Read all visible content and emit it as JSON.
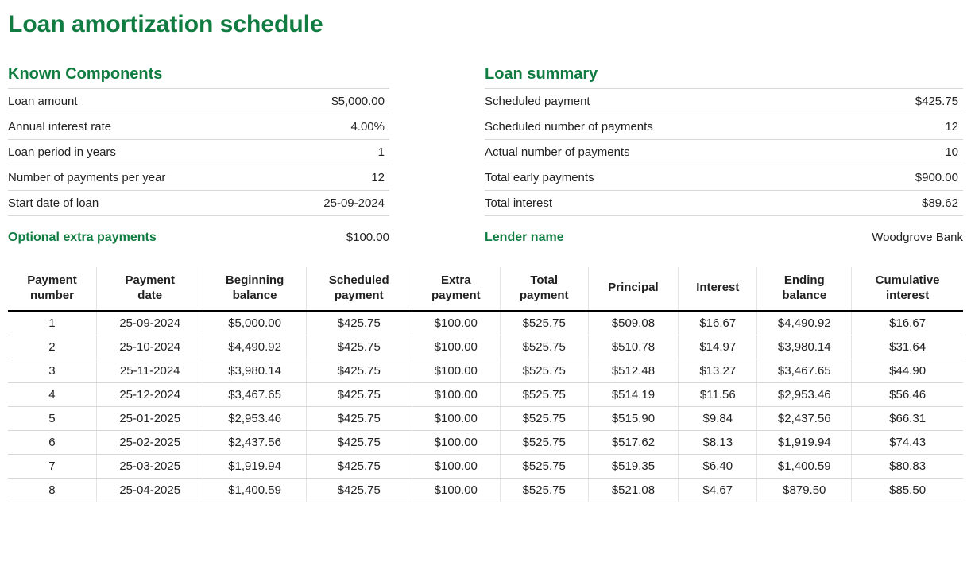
{
  "title": "Loan amortization schedule",
  "known": {
    "heading": "Known Components",
    "rows": [
      {
        "label": "Loan amount",
        "value": "$5,000.00"
      },
      {
        "label": "Annual interest rate",
        "value": "4.00%"
      },
      {
        "label": "Loan period in years",
        "value": "1"
      },
      {
        "label": "Number of payments per year",
        "value": "12"
      },
      {
        "label": "Start date of loan",
        "value": "25-09-2024"
      }
    ],
    "extra_label": "Optional extra payments",
    "extra_value": "$100.00"
  },
  "summary": {
    "heading": "Loan summary",
    "rows": [
      {
        "label": "Scheduled payment",
        "value": "$425.75"
      },
      {
        "label": "Scheduled number of payments",
        "value": "12"
      },
      {
        "label": "Actual number of payments",
        "value": "10"
      },
      {
        "label": "Total early payments",
        "value": "$900.00"
      },
      {
        "label": "Total interest",
        "value": "$89.62"
      }
    ],
    "lender_label": "Lender name",
    "lender_value": "Woodgrove Bank"
  },
  "schedule": {
    "headers": [
      "Payment number",
      "Payment date",
      "Beginning balance",
      "Scheduled payment",
      "Extra payment",
      "Total payment",
      "Principal",
      "Interest",
      "Ending balance",
      "Cumulative interest"
    ],
    "rows": [
      [
        "1",
        "25-09-2024",
        "$5,000.00",
        "$425.75",
        "$100.00",
        "$525.75",
        "$509.08",
        "$16.67",
        "$4,490.92",
        "$16.67"
      ],
      [
        "2",
        "25-10-2024",
        "$4,490.92",
        "$425.75",
        "$100.00",
        "$525.75",
        "$510.78",
        "$14.97",
        "$3,980.14",
        "$31.64"
      ],
      [
        "3",
        "25-11-2024",
        "$3,980.14",
        "$425.75",
        "$100.00",
        "$525.75",
        "$512.48",
        "$13.27",
        "$3,467.65",
        "$44.90"
      ],
      [
        "4",
        "25-12-2024",
        "$3,467.65",
        "$425.75",
        "$100.00",
        "$525.75",
        "$514.19",
        "$11.56",
        "$2,953.46",
        "$56.46"
      ],
      [
        "5",
        "25-01-2025",
        "$2,953.46",
        "$425.75",
        "$100.00",
        "$525.75",
        "$515.90",
        "$9.84",
        "$2,437.56",
        "$66.31"
      ],
      [
        "6",
        "25-02-2025",
        "$2,437.56",
        "$425.75",
        "$100.00",
        "$525.75",
        "$517.62",
        "$8.13",
        "$1,919.94",
        "$74.43"
      ],
      [
        "7",
        "25-03-2025",
        "$1,919.94",
        "$425.75",
        "$100.00",
        "$525.75",
        "$519.35",
        "$6.40",
        "$1,400.59",
        "$80.83"
      ],
      [
        "8",
        "25-04-2025",
        "$1,400.59",
        "$425.75",
        "$100.00",
        "$525.75",
        "$521.08",
        "$4.67",
        "$879.50",
        "$85.50"
      ]
    ]
  }
}
